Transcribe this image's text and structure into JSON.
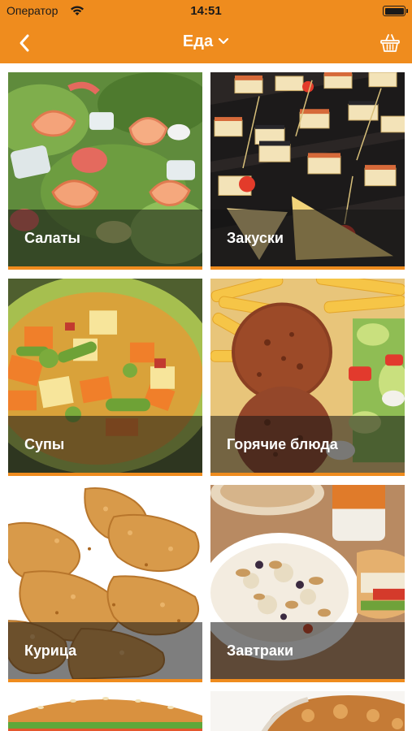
{
  "status_bar": {
    "carrier": "Оператор",
    "time": "14:51"
  },
  "nav": {
    "title": "Еда",
    "back_icon": "chevron-left-icon",
    "title_icon": "chevron-down-icon",
    "basket_icon": "basket-icon"
  },
  "colors": {
    "accent": "#ef8c1e",
    "label": "#ffffff"
  },
  "categories": [
    {
      "label": "Салаты",
      "image": "salad"
    },
    {
      "label": "Закуски",
      "image": "canapes"
    },
    {
      "label": "Супы",
      "image": "vegetable-soup"
    },
    {
      "label": "Горячие блюда",
      "image": "meatballs-with-fries"
    },
    {
      "label": "Курица",
      "image": "fried-chicken"
    },
    {
      "label": "Завтраки",
      "image": "oatmeal-breakfast"
    },
    {
      "label": "",
      "image": "burger"
    },
    {
      "label": "",
      "image": "pastry"
    }
  ]
}
